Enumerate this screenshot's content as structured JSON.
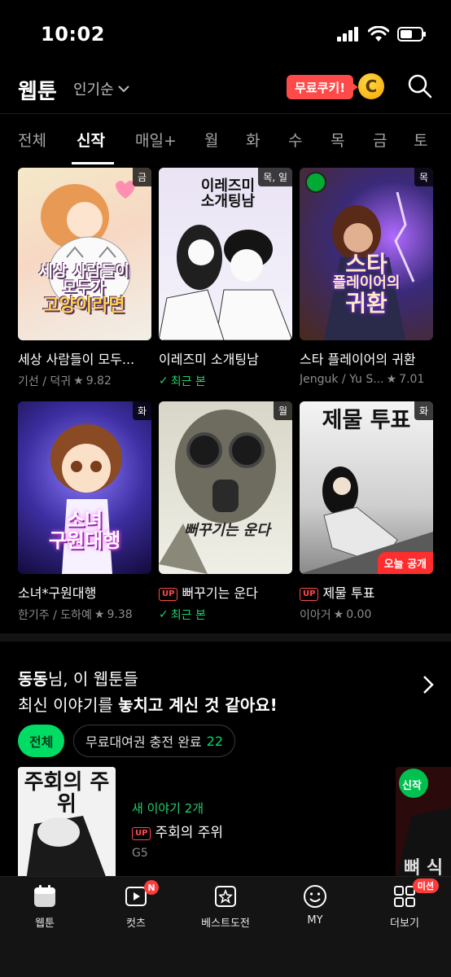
{
  "status": {
    "time": "10:02"
  },
  "header": {
    "logo": "웹툰",
    "sort_label": "인기순",
    "free_badge": "무료쿠키!",
    "cookie_glyph": "C"
  },
  "tabs": [
    {
      "label": "전체"
    },
    {
      "label": "신작"
    },
    {
      "label": "매일+"
    },
    {
      "label": "월"
    },
    {
      "label": "화"
    },
    {
      "label": "수"
    },
    {
      "label": "목"
    },
    {
      "label": "금"
    },
    {
      "label": "토"
    }
  ],
  "active_tab": "신작",
  "cards": [
    {
      "title": "세상 사람들이 모두...",
      "sub": "기선 / 덕귀",
      "rating": "9.82",
      "day": "금",
      "art": [
        "세상 사람들이",
        "모두가",
        "고양이라면"
      ]
    },
    {
      "title": "이레즈미 소개팅남",
      "sub": "최근 본",
      "day": "목, 일",
      "art": [
        "이레즈미",
        "소개팅남"
      ]
    },
    {
      "title": "스타 플레이어의 귀환",
      "sub": "Jenguk / Yu S...",
      "rating": "7.01",
      "day": "목",
      "art": [
        "스타",
        "플레이어의",
        "귀환"
      ]
    },
    {
      "title": "소녀*구원대행",
      "sub": "한기주 / 도하예",
      "rating": "9.38",
      "day": "화",
      "art": [
        "소녀",
        "구원대행"
      ]
    },
    {
      "title": "뻐꾸기는 운다",
      "up": "UP",
      "sub": "최근 본",
      "day": "월",
      "art": [
        "뻐꾸기는 운다"
      ]
    },
    {
      "title": "제물 투표",
      "up": "UP",
      "sub": "이아거",
      "rating": "0.00",
      "day": "화",
      "art": [
        "제물 투표"
      ],
      "today": "오늘 공개"
    }
  ],
  "recommend": {
    "line1_name": "동동",
    "line1_rest": "님, 이 웹툰들",
    "line2_a": "최신 이야기를 ",
    "line2_b": "놓치고 계신 것 같아요!",
    "chip_all": "전체",
    "chip_free": "무료대여권 충전 완료",
    "chip_free_count": "22",
    "item": {
      "new_label": "새 이야기 2개",
      "up": "UP",
      "title": "주회의 주위",
      "author": "G5",
      "thumb_text": "주회의 주위"
    },
    "item2": {
      "badge": "신작",
      "thumb_text": "뼈 식"
    }
  },
  "nav": [
    {
      "label": "웹툰",
      "icon": "calendar-icon"
    },
    {
      "label": "컷츠",
      "icon": "play-icon",
      "badge": "N"
    },
    {
      "label": "베스트도전",
      "icon": "star-icon"
    },
    {
      "label": "MY",
      "icon": "smile-icon"
    },
    {
      "label": "더보기",
      "icon": "grid-icon",
      "badge": "미션"
    }
  ],
  "colors": {
    "accent": "#00dc64",
    "red": "#ff4a4a",
    "bg": "#000000"
  }
}
